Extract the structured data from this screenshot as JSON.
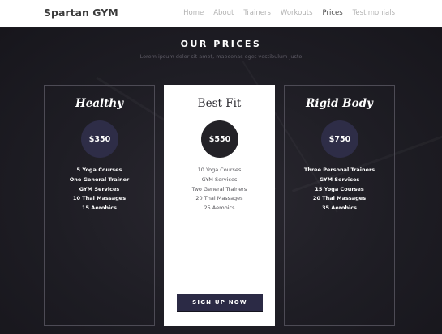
{
  "navbar": {
    "brand": "Spartan GYM",
    "links": [
      {
        "label": "Home",
        "active": false
      },
      {
        "label": "About",
        "active": false
      },
      {
        "label": "Trainers",
        "active": false
      },
      {
        "label": "Workouts",
        "active": false
      },
      {
        "label": "Prices",
        "active": true
      },
      {
        "label": "Testimonials",
        "active": false
      }
    ]
  },
  "prices": {
    "title": "OUR PRICES",
    "subtitle": "Lorem ipsum dolor sit amet, maecenas eget vestibulum justo",
    "cards": [
      {
        "name": "Healthy",
        "price": "$350",
        "features": [
          "5 Yoga Courses",
          "One General Trainer",
          "GYM Services",
          "10 Thai Massages",
          "15 Aerobics"
        ]
      },
      {
        "name": "Best Fit",
        "price": "$550",
        "features": [
          "10 Yoga Courses",
          "GYM Services",
          "Two General Trainers",
          "20 Thai Massages",
          "25 Aerobics"
        ],
        "button": "SIGN UP NOW"
      },
      {
        "name": "Rigid Body",
        "price": "$750",
        "features": [
          "Three Personal Trainers",
          "GYM Services",
          "15 Yoga Courses",
          "20 Thai Massages",
          "35 Aerobics"
        ]
      }
    ]
  },
  "colors": {
    "background": "#1b1a20",
    "accent_navy": "#2e2d47",
    "featured_card": "#ffffff"
  }
}
